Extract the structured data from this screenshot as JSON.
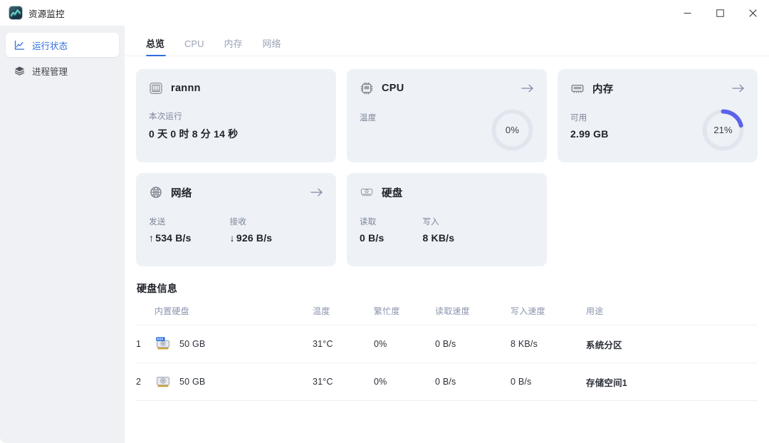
{
  "window": {
    "title": "资源监控",
    "app_icon": "chart-app-icon",
    "controls": [
      {
        "name": "minimize",
        "glyph": "—"
      },
      {
        "name": "maximize",
        "glyph": "□"
      },
      {
        "name": "close",
        "glyph": "✕"
      }
    ]
  },
  "sidebar": {
    "items": [
      {
        "label": "运行状态",
        "icon": "activity-chart-icon",
        "active": true
      },
      {
        "label": "进程管理",
        "icon": "layers-icon",
        "active": false
      }
    ]
  },
  "tabs": [
    {
      "label": "总览",
      "active": true
    },
    {
      "label": "CPU",
      "active": false
    },
    {
      "label": "内存",
      "active": false
    },
    {
      "label": "网络",
      "active": false
    }
  ],
  "cards": {
    "uptime": {
      "title": "rannn",
      "icon": "server-rack-icon",
      "label": "本次运行",
      "value": "0 天 0 时 8 分 14 秒"
    },
    "cpu": {
      "title": "CPU",
      "icon": "cpu-chip-icon",
      "label": "温度",
      "value": "",
      "ring_percent": 0,
      "ring_text": "0%",
      "arrow": "arrow-right-icon"
    },
    "memory": {
      "title": "内存",
      "icon": "ram-stick-icon",
      "label": "可用",
      "value": "2.99 GB",
      "ring_percent": 21,
      "ring_text": "21%",
      "arrow": "arrow-right-icon"
    },
    "network": {
      "title": "网络",
      "icon": "globe-network-icon",
      "arrow": "arrow-right-icon",
      "sent_label": "发送",
      "sent_dir": "↑",
      "sent_value": "534 B/s",
      "recv_label": "接收",
      "recv_dir": "↓",
      "recv_value": "926 B/s"
    },
    "disk": {
      "title": "硬盘",
      "icon": "hard-disk-icon",
      "read_label": "读取",
      "read_value": "0 B/s",
      "write_label": "写入",
      "write_value": "8 KB/s"
    }
  },
  "disk_section": {
    "title": "硬盘信息",
    "columns": [
      "",
      "内置硬盘",
      "温度",
      "繁忙度",
      "读取速度",
      "写入速度",
      "用途"
    ],
    "rows": [
      {
        "index": "1",
        "name": "50 GB",
        "temperature": "31°C",
        "busy": "0%",
        "read": "0 B/s",
        "write": "8 KB/s",
        "usage": "系统分区",
        "system_badge": true
      },
      {
        "index": "2",
        "name": "50 GB",
        "temperature": "31°C",
        "busy": "0%",
        "read": "0 B/s",
        "write": "0 B/s",
        "usage": "存储空间1",
        "system_badge": false
      }
    ]
  },
  "colors": {
    "accent": "#2f6fe0",
    "ring_active": "#5b62ea",
    "ring_track": "#e2e5ee",
    "card_bg": "#eef1f6",
    "sidebar_bg": "#f0f1f5"
  }
}
